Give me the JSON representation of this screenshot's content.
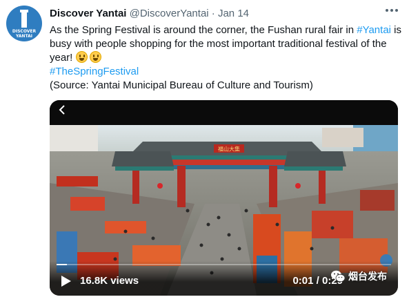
{
  "tweet": {
    "avatar_text_line1": "DISCOVER",
    "avatar_text_line2": "YANTAI",
    "display_name": "Discover Yantai",
    "handle": "@DiscoverYantai",
    "separator": "·",
    "date": "Jan 14",
    "text_part1": "As the Spring Festival is around the corner, the Fushan rural fair in ",
    "hashtag_yantai": "#Yantai",
    "text_part2": " is busy with people shopping for the most important traditional festival of the year!",
    "emojis": [
      "grinning-face",
      "grinning-face"
    ],
    "hashtag_spring": "#TheSpringFestival",
    "source_line": "(Source: Yantai Municipal Bureau of Culture and Tourism)",
    "gate_sign": "福山大集"
  },
  "video": {
    "views": "16.8K views",
    "timecode": "0:01 / 0:29",
    "progress": 0.03,
    "watermark": "烟台发布",
    "icons": [
      "back-chevron-icon",
      "play-icon",
      "wechat-logo-icon"
    ]
  },
  "colors": {
    "accent": "#1d9bf0",
    "text": "#0f1419",
    "muted": "#536471",
    "avatar_bg": "#2f7dc0"
  }
}
